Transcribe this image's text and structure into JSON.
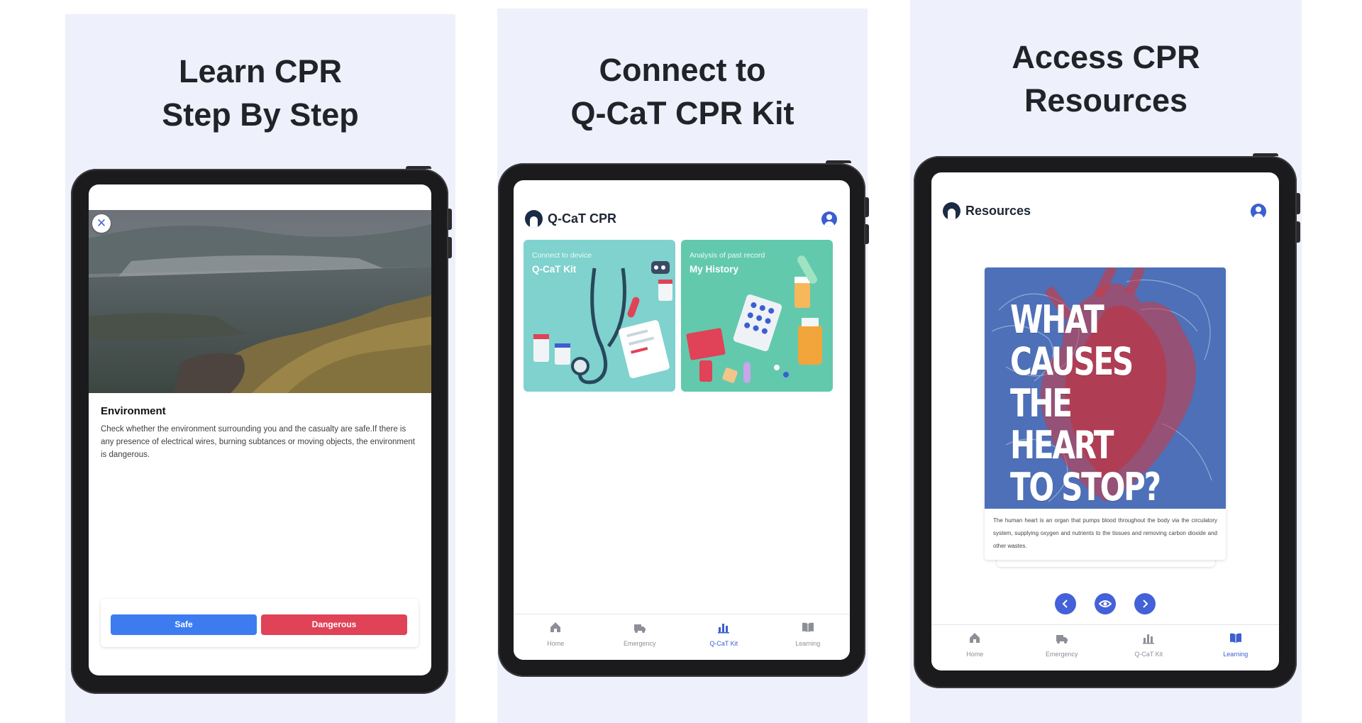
{
  "panels": [
    {
      "headline": "Learn CPR\nStep By Step",
      "screen": {
        "scenario_title": "Environment",
        "scenario_body": "Check whether the environment surrounding you and the casualty are safe.If there is any presence of electrical wires, burning subtances or moving objects, the environment is dangerous.",
        "safe_label": "Safe",
        "danger_label": "Dangerous",
        "close_icon": "close-icon"
      }
    },
    {
      "headline": "Connect to\nQ-CaT CPR Kit",
      "screen": {
        "app_title": "Q-CaT CPR",
        "cards": [
          {
            "subtitle": "Connect to device",
            "title": "Q-CaT Kit"
          },
          {
            "subtitle": "Analysis of past record",
            "title": "My History"
          }
        ]
      }
    },
    {
      "headline": "Access CPR\nResources",
      "screen": {
        "app_title": "Resources",
        "poster_text": "WHAT\nCAUSES\nTHE HEART\nTO STOP?",
        "description": "The human heart is an organ that pumps blood throughout the body via the circulatory system, supplying oxygen and nutrients to the tissues and removing carbon dioxide and other wastes.",
        "carousel": {
          "prev_icon": "chevron-left-icon",
          "view_icon": "eye-icon",
          "next_icon": "chevron-right-icon"
        }
      }
    }
  ],
  "nav": {
    "home": "Home",
    "emergency": "Emergency",
    "kit": "Q-CaT Kit",
    "learning": "Learning"
  },
  "colors": {
    "panel_bg": "#eef0fb",
    "accent": "#3b5fd1",
    "safe": "#3d7cf0",
    "danger": "#e04257",
    "poster_bg": "#4d70b8"
  }
}
